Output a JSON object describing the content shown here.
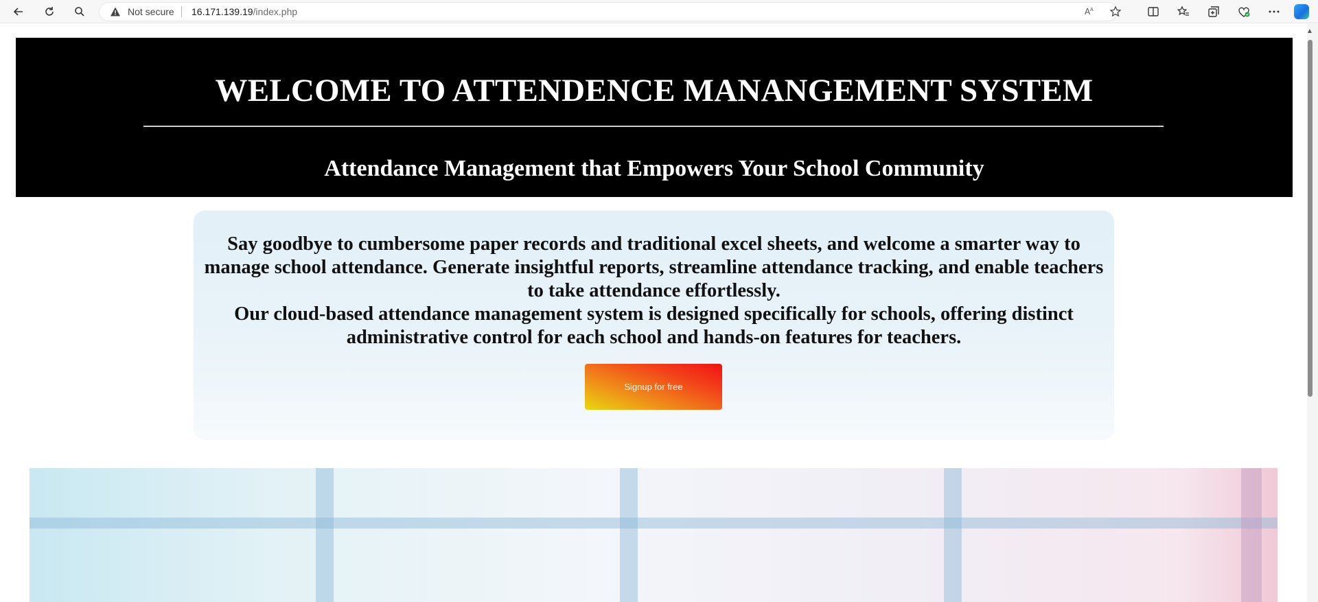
{
  "browser": {
    "security_label": "Not secure",
    "url_host": "16.171.139.19",
    "url_path": "/index.php",
    "icons": [
      "back-arrow-icon",
      "refresh-icon",
      "search-icon",
      "warning-icon",
      "read-aloud-icon",
      "favorite-star-icon",
      "split-screen-icon",
      "favorites-icon",
      "collections-icon",
      "browser-essentials-icon",
      "more-icon",
      "copilot-icon"
    ]
  },
  "hero": {
    "title": "WELCOME TO ATTENDENCE MANANGEMENT SYSTEM",
    "subtitle": "Attendance Management that Empowers Your School Community"
  },
  "intro": {
    "paragraph_1": "Say goodbye to cumbersome paper records and traditional excel sheets, and welcome a smarter way to manage school attendance. Generate insightful reports, streamline attendance tracking, and enable teachers to take attendance effortlessly.",
    "paragraph_2": "Our cloud-based attendance management system is designed specifically for schools, offering distinct administrative control for each school and hands-on features for teachers.",
    "signup_label": "Signup for free"
  },
  "colors": {
    "hero_background": "#000000",
    "signup_gradient_start": "#e8d710",
    "signup_gradient_end": "#f11212",
    "intro_background": "#e3f0f8"
  }
}
